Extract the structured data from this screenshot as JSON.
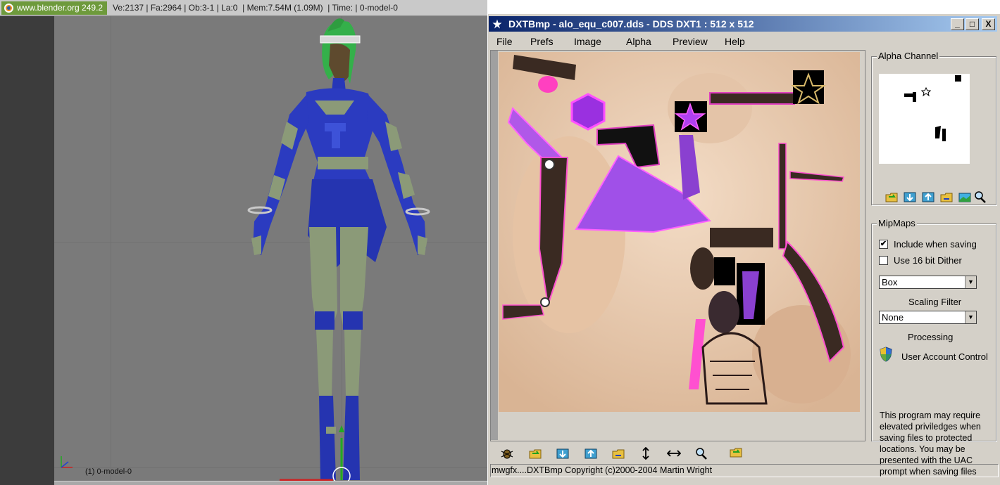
{
  "blender": {
    "logo_text": "www.blender.org 249.2",
    "stats": "Ve:2137 | Fa:2964 | Ob:3-1 | La:0  | Mem:7.54M (1.09M)  | Time: | 0-model-0",
    "object_label": "(1) 0-model-0"
  },
  "dxtbmp": {
    "title": "DXTBmp - alo_equ_c007.dds - DDS DXT1 : 512 x 512",
    "window_buttons": {
      "minimize": "_",
      "maximize": "□",
      "close": "X"
    },
    "menu": [
      "File",
      "Prefs",
      "Image",
      "Alpha",
      "Preview",
      "Help"
    ],
    "alpha_channel_label": "Alpha Channel",
    "mipmaps": {
      "label": "MipMaps",
      "include_when_saving": {
        "label": "Include when saving",
        "checked": true
      },
      "use_16bit_dither": {
        "label": "Use 16 bit Dither",
        "checked": false
      },
      "filter_select": "Box",
      "scaling_filter_label": "Scaling Filter",
      "scaling_select": "None"
    },
    "processing_label": "Processing",
    "uac_title": "User Account Control",
    "uac_text": "This program may require elevated priviledges when saving files to protected locations. You may be presented with the UAC prompt when saving files",
    "status": "mwgfx....DXTBmp Copyright (c)2000-2004 Martin Wright"
  }
}
